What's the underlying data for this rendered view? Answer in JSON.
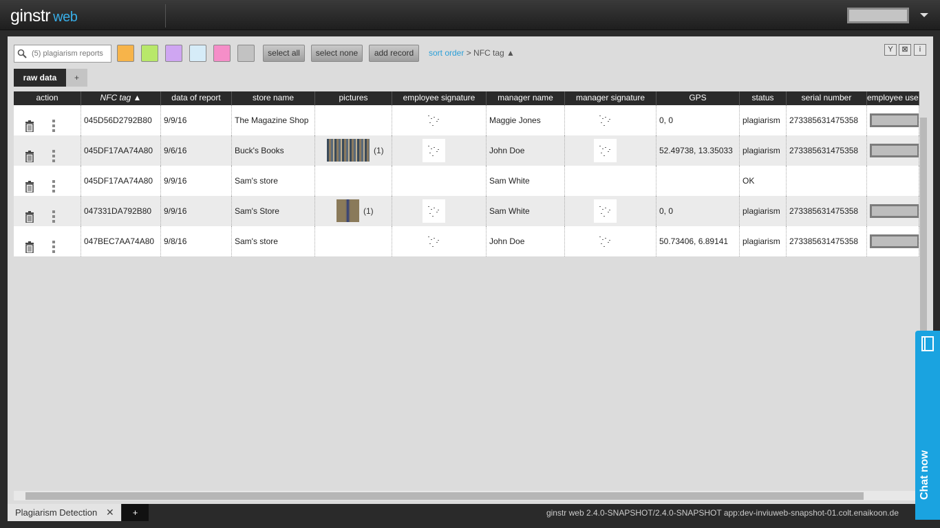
{
  "app": {
    "logo_main": "ginstr",
    "logo_sub": "web"
  },
  "toolbar": {
    "search_placeholder": "(5) plagiarism reports",
    "swatches": [
      "#f7b44a",
      "#b8e86a",
      "#cfa6f2",
      "#d6ecf8",
      "#f58ec8",
      "#c2c2c2"
    ],
    "select_all": "select all",
    "select_none": "select none",
    "add_record": "add record",
    "sort_order_label": "sort order",
    "sort_sep": " > ",
    "sort_field": "NFC tag ▲",
    "icons": [
      "filter-icon",
      "clear-filter-icon",
      "info-icon"
    ],
    "icon_glyphs": [
      "Y",
      "⊠",
      "i"
    ]
  },
  "tabs": {
    "active": "raw data",
    "add": "+"
  },
  "table": {
    "columns": [
      "action",
      "NFC tag ▲",
      "data of report",
      "store name",
      "pictures",
      "employee signature",
      "manager name",
      "manager signature",
      "GPS",
      "status",
      "serial number",
      "employee usern"
    ],
    "rows": [
      {
        "nfc": "045D56D2792B80",
        "date": "9/9/16",
        "store": "The Magazine Shop",
        "picture_count": "",
        "emp_sig": true,
        "manager": "Maggie Jones",
        "mgr_sig": true,
        "gps": "0, 0",
        "status": "plagiarism",
        "serial": "273385631475358",
        "user": true
      },
      {
        "nfc": "045DF17AA74A80",
        "date": "9/6/16",
        "store": "Buck's Books",
        "picture_count": "(1)",
        "emp_sig": true,
        "manager": "John Doe",
        "mgr_sig": true,
        "gps": "52.49738, 13.35033",
        "status": "plagiarism",
        "serial": "273385631475358",
        "user": true
      },
      {
        "nfc": "045DF17AA74A80",
        "date": "9/9/16",
        "store": "Sam's store",
        "picture_count": "",
        "emp_sig": false,
        "manager": "Sam White",
        "mgr_sig": false,
        "gps": "",
        "status": "OK",
        "serial": "",
        "user": false
      },
      {
        "nfc": "047331DA792B80",
        "date": "9/9/16",
        "store": "Sam's Store",
        "picture_count": "(1)",
        "emp_sig": true,
        "manager": "Sam White",
        "mgr_sig": true,
        "gps": "0, 0",
        "status": "plagiarism",
        "serial": "273385631475358",
        "user": true
      },
      {
        "nfc": "047BEC7AA74A80",
        "date": "9/8/16",
        "store": "Sam's store",
        "picture_count": "",
        "emp_sig": true,
        "manager": "John Doe",
        "mgr_sig": true,
        "gps": "50.73406, 6.89141",
        "status": "plagiarism",
        "serial": "273385631475358",
        "user": true
      }
    ]
  },
  "bottom": {
    "tab_label": "Plagiarism Detection",
    "tab_close": "✕",
    "add_tab": "+",
    "version": "ginstr web 2.4.0-SNAPSHOT/2.4.0-SNAPSHOT app:dev-inviuweb-snapshot-01.colt.enaikoon.de"
  },
  "chat": {
    "label": "Chat now"
  }
}
